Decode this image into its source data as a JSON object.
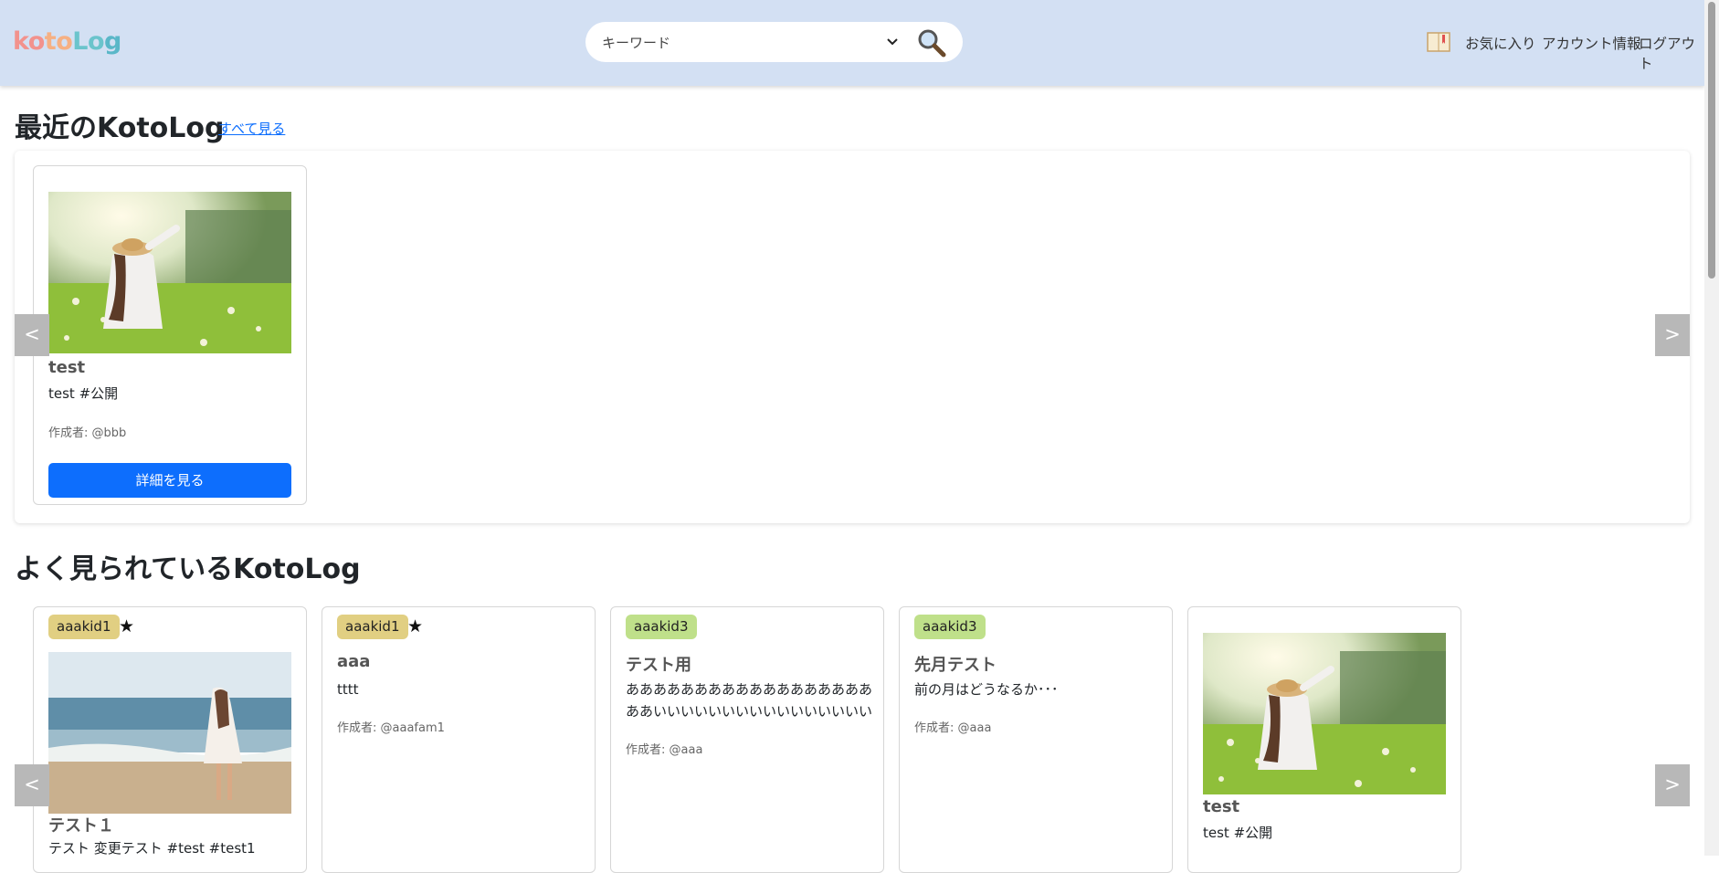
{
  "header": {
    "logo": [
      "ko",
      "to",
      "Lo",
      "g"
    ],
    "search_placeholder": "キーワード",
    "nav": {
      "favorites": "お気に入り",
      "account": "アカウント情報",
      "logout": "ログアウト"
    }
  },
  "recent": {
    "title": "最近のKotoLog",
    "see_all": "すべて見る",
    "prev": "<",
    "next": ">",
    "cards": [
      {
        "title": "test",
        "text": "test #公開",
        "author": "作成者: @bbb",
        "button": "詳細を見る",
        "image": "meadow-photo"
      }
    ]
  },
  "popular": {
    "title": "よく見られているKotoLog",
    "prev": "<",
    "next": ">",
    "cards": [
      {
        "badge": "aaakid1",
        "star": "★",
        "title": "テスト１",
        "text": "テスト 変更テスト #test #test1",
        "image": "beach-photo"
      },
      {
        "badge": "aaakid1",
        "star": "★",
        "title": "aaa",
        "text": "tttt",
        "author": "作成者: @aaafam1"
      },
      {
        "badge": "aaakid3",
        "title": "テスト用",
        "text": "ああああああああああああああああああああいいいいいいいいいいいいいいいいいいい...",
        "author": "作成者: @aaa"
      },
      {
        "badge": "aaakid3",
        "title": "先月テスト",
        "text": "前の月はどうなるか･･･",
        "author": "作成者: @aaa"
      },
      {
        "title": "test",
        "text": "test #公開",
        "image": "meadow-photo"
      }
    ]
  },
  "colors": {
    "header_bg": "#d3e0f3",
    "primary": "#0d6efd",
    "badge_kid1": "#e1cf82",
    "badge_kid3": "#bfe08a"
  }
}
